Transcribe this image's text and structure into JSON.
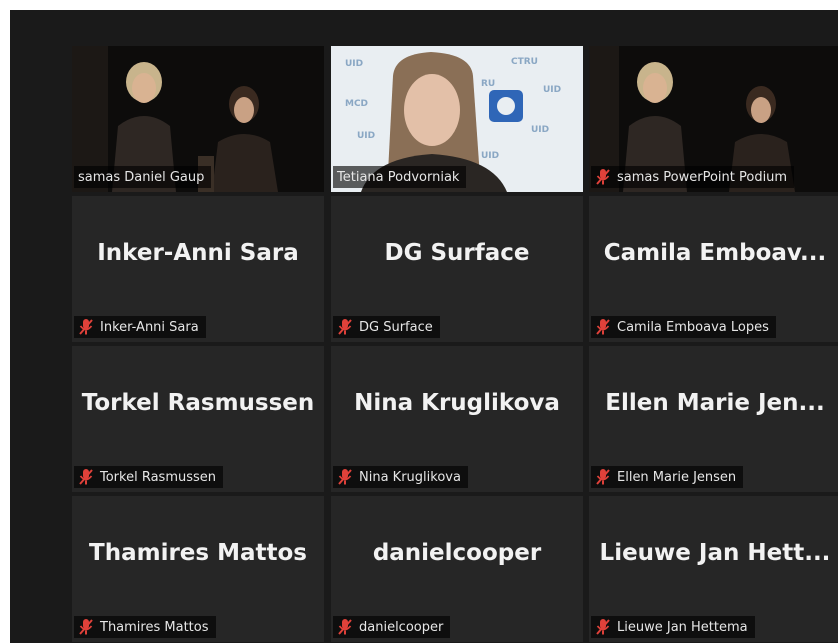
{
  "meeting": {
    "tiles": [
      {
        "big_name": "",
        "label": "samas Daniel Gaup",
        "muted": false,
        "video": "stage",
        "active": true
      },
      {
        "big_name": "",
        "label": "Tetiana Podvorniak",
        "muted": false,
        "video": "webcam",
        "active": false
      },
      {
        "big_name": "",
        "label": "samas PowerPoint Podium",
        "muted": true,
        "video": "stage",
        "active": false
      },
      {
        "big_name": "Inker-Anni Sara",
        "label": "Inker-Anni Sara",
        "muted": true
      },
      {
        "big_name": "DG Surface",
        "label": "DG Surface",
        "muted": true
      },
      {
        "big_name": "Camila  Emboav...",
        "label": "Camila Emboava Lopes",
        "muted": true
      },
      {
        "big_name": "Torkel Rasmussen",
        "label": "Torkel Rasmussen",
        "muted": true
      },
      {
        "big_name": "Nina Kruglikova",
        "label": "Nina Kruglikova",
        "muted": true
      },
      {
        "big_name": "Ellen  Marie  Jen...",
        "label": "Ellen Marie Jensen",
        "muted": true
      },
      {
        "big_name": "Thamires Mattos",
        "label": "Thamires Mattos",
        "muted": true
      },
      {
        "big_name": "danielcooper",
        "label": "danielcooper",
        "muted": true
      },
      {
        "big_name": "Lieuwe  Jan  Hett...",
        "label": "Lieuwe Jan Hettema",
        "muted": true
      }
    ],
    "colors": {
      "active_border": "#e0dc6e",
      "mic_muted": "#e0413a"
    }
  }
}
